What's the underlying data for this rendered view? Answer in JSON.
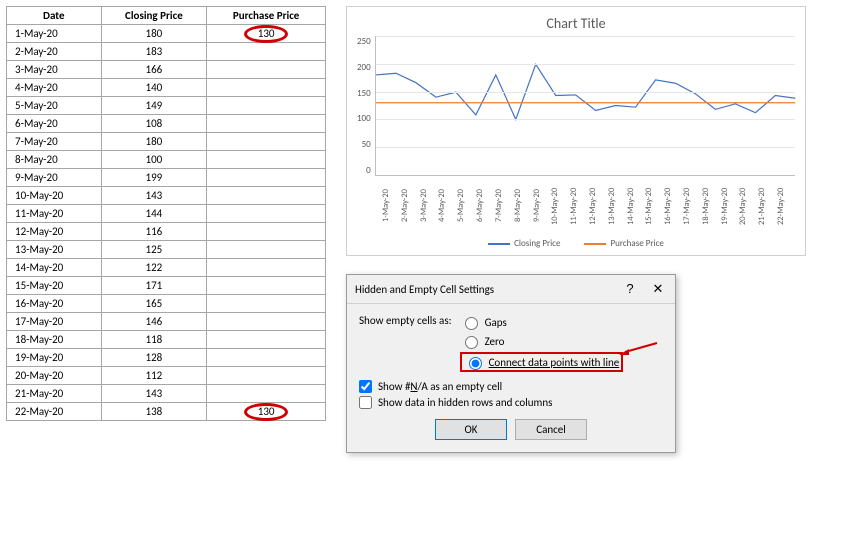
{
  "table": {
    "headers": [
      "Date",
      "Closing Price",
      "Purchase Price"
    ],
    "rows": [
      {
        "date": "1-May-20",
        "closing": 180,
        "purchase": 130,
        "circle_purchase": true
      },
      {
        "date": "2-May-20",
        "closing": 183
      },
      {
        "date": "3-May-20",
        "closing": 166
      },
      {
        "date": "4-May-20",
        "closing": 140
      },
      {
        "date": "5-May-20",
        "closing": 149
      },
      {
        "date": "6-May-20",
        "closing": 108
      },
      {
        "date": "7-May-20",
        "closing": 180
      },
      {
        "date": "8-May-20",
        "closing": 100
      },
      {
        "date": "9-May-20",
        "closing": 199
      },
      {
        "date": "10-May-20",
        "closing": 143
      },
      {
        "date": "11-May-20",
        "closing": 144
      },
      {
        "date": "12-May-20",
        "closing": 116
      },
      {
        "date": "13-May-20",
        "closing": 125
      },
      {
        "date": "14-May-20",
        "closing": 122
      },
      {
        "date": "15-May-20",
        "closing": 171
      },
      {
        "date": "16-May-20",
        "closing": 165
      },
      {
        "date": "17-May-20",
        "closing": 146
      },
      {
        "date": "18-May-20",
        "closing": 118
      },
      {
        "date": "19-May-20",
        "closing": 128
      },
      {
        "date": "20-May-20",
        "closing": 112
      },
      {
        "date": "21-May-20",
        "closing": 143
      },
      {
        "date": "22-May-20",
        "closing": 138,
        "purchase": 130,
        "circle_purchase": true
      }
    ]
  },
  "chart_data": {
    "type": "line",
    "title": "Chart Title",
    "ylim": [
      0,
      250
    ],
    "yticks": [
      0,
      50,
      100,
      150,
      200,
      250
    ],
    "categories": [
      "1-May-20",
      "2-May-20",
      "3-May-20",
      "4-May-20",
      "5-May-20",
      "6-May-20",
      "7-May-20",
      "8-May-20",
      "9-May-20",
      "10-May-20",
      "11-May-20",
      "12-May-20",
      "13-May-20",
      "14-May-20",
      "15-May-20",
      "16-May-20",
      "17-May-20",
      "18-May-20",
      "19-May-20",
      "20-May-20",
      "21-May-20",
      "22-May-20"
    ],
    "series": [
      {
        "name": "Closing Price",
        "color": "#4472C4",
        "values": [
          180,
          183,
          166,
          140,
          149,
          108,
          180,
          100,
          199,
          143,
          144,
          116,
          125,
          122,
          171,
          165,
          146,
          118,
          128,
          112,
          143,
          138
        ]
      },
      {
        "name": "Purchase Price",
        "color": "#ED7D31",
        "values": [
          130,
          130,
          130,
          130,
          130,
          130,
          130,
          130,
          130,
          130,
          130,
          130,
          130,
          130,
          130,
          130,
          130,
          130,
          130,
          130,
          130,
          130
        ]
      }
    ]
  },
  "dialog": {
    "title": "Hidden and Empty Cell Settings",
    "help_symbol": "?",
    "close_symbol": "✕",
    "show_label": "Show empty cells as:",
    "radios": {
      "gaps": "Gaps",
      "zero": "Zero",
      "connect": "Connect data points with line"
    },
    "selected_radio": "connect",
    "check_na": {
      "label_pre": "Show #",
      "label_u": "N",
      "label_post": "/A as an empty cell",
      "checked": true
    },
    "check_hidden": {
      "label": "Show data in hidden rows and columns",
      "checked": false
    },
    "ok": "OK",
    "cancel": "Cancel"
  }
}
